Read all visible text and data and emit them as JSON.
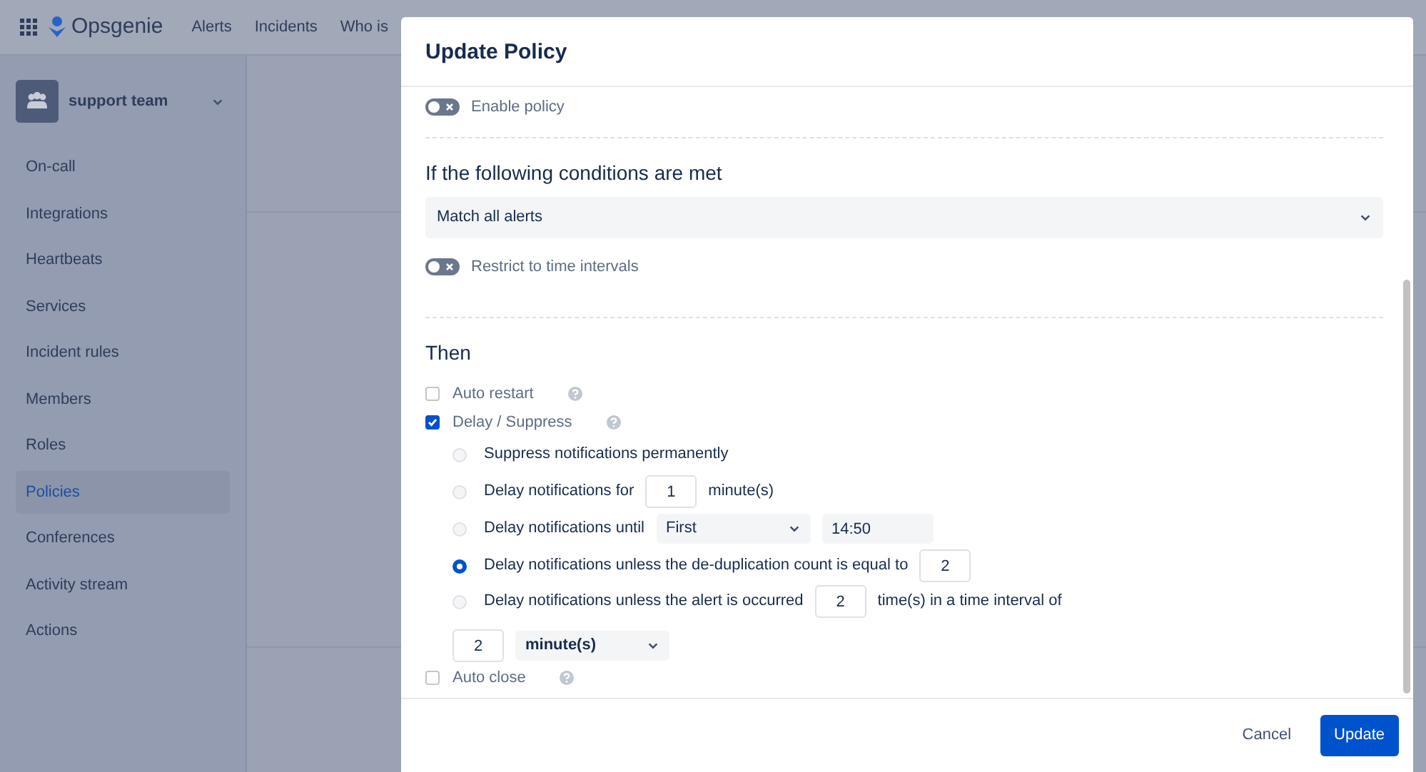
{
  "topnav": {
    "app_name": "Opsgenie",
    "items": [
      "Alerts",
      "Incidents",
      "Who is"
    ]
  },
  "sidebar": {
    "team": "support team",
    "items": [
      {
        "label": "On-call",
        "selected": false
      },
      {
        "label": "Integrations",
        "selected": false
      },
      {
        "label": "Heartbeats",
        "selected": false
      },
      {
        "label": "Services",
        "selected": false
      },
      {
        "label": "Incident rules",
        "selected": false
      },
      {
        "label": "Members",
        "selected": false
      },
      {
        "label": "Roles",
        "selected": false
      },
      {
        "label": "Policies",
        "selected": true
      },
      {
        "label": "Conferences",
        "selected": false
      },
      {
        "label": "Activity stream",
        "selected": false
      },
      {
        "label": "Actions",
        "selected": false
      }
    ]
  },
  "modal": {
    "title": "Update Policy",
    "enable_policy": {
      "label": "Enable policy",
      "on": false
    },
    "conditions": {
      "heading": "If the following conditions are met",
      "select": "Match all alerts"
    },
    "restrict": {
      "label": "Restrict to time intervals",
      "on": false
    },
    "then": {
      "heading": "Then",
      "options": [
        {
          "label": "Auto restart",
          "checked": false
        },
        {
          "label": "Delay / Suppress",
          "checked": true,
          "radios": [
            {
              "selected": false,
              "parts": [
                {
                  "kind": "text",
                  "text": "Suppress notifications permanently"
                }
              ]
            },
            {
              "selected": false,
              "parts": [
                {
                  "kind": "text",
                  "text": "Delay notifications for"
                },
                {
                  "kind": "field",
                  "value": "1"
                },
                {
                  "kind": "text",
                  "text": "minute(s)"
                }
              ]
            },
            {
              "selected": false,
              "parts": [
                {
                  "kind": "text",
                  "text": "Delay notifications until"
                },
                {
                  "kind": "select",
                  "value": "First"
                },
                {
                  "kind": "time",
                  "value": "14:50"
                }
              ]
            },
            {
              "selected": true,
              "parts": [
                {
                  "kind": "text",
                  "text": "Delay notifications unless the de-duplication count is equal to"
                },
                {
                  "kind": "field",
                  "value": "2"
                }
              ]
            },
            {
              "selected": false,
              "parts": [
                {
                  "kind": "text",
                  "text": "Delay notifications unless the alert is occurred"
                },
                {
                  "kind": "field",
                  "value": "2"
                },
                {
                  "kind": "text",
                  "text": "time(s) in a time interval of"
                },
                {
                  "kind": "break"
                },
                {
                  "kind": "field",
                  "value": "2"
                },
                {
                  "kind": "unit",
                  "value": "minute(s)"
                }
              ]
            }
          ]
        },
        {
          "label": "Auto close",
          "checked": false
        }
      ]
    },
    "footer": {
      "cancel": "Cancel",
      "submit": "Update"
    }
  }
}
